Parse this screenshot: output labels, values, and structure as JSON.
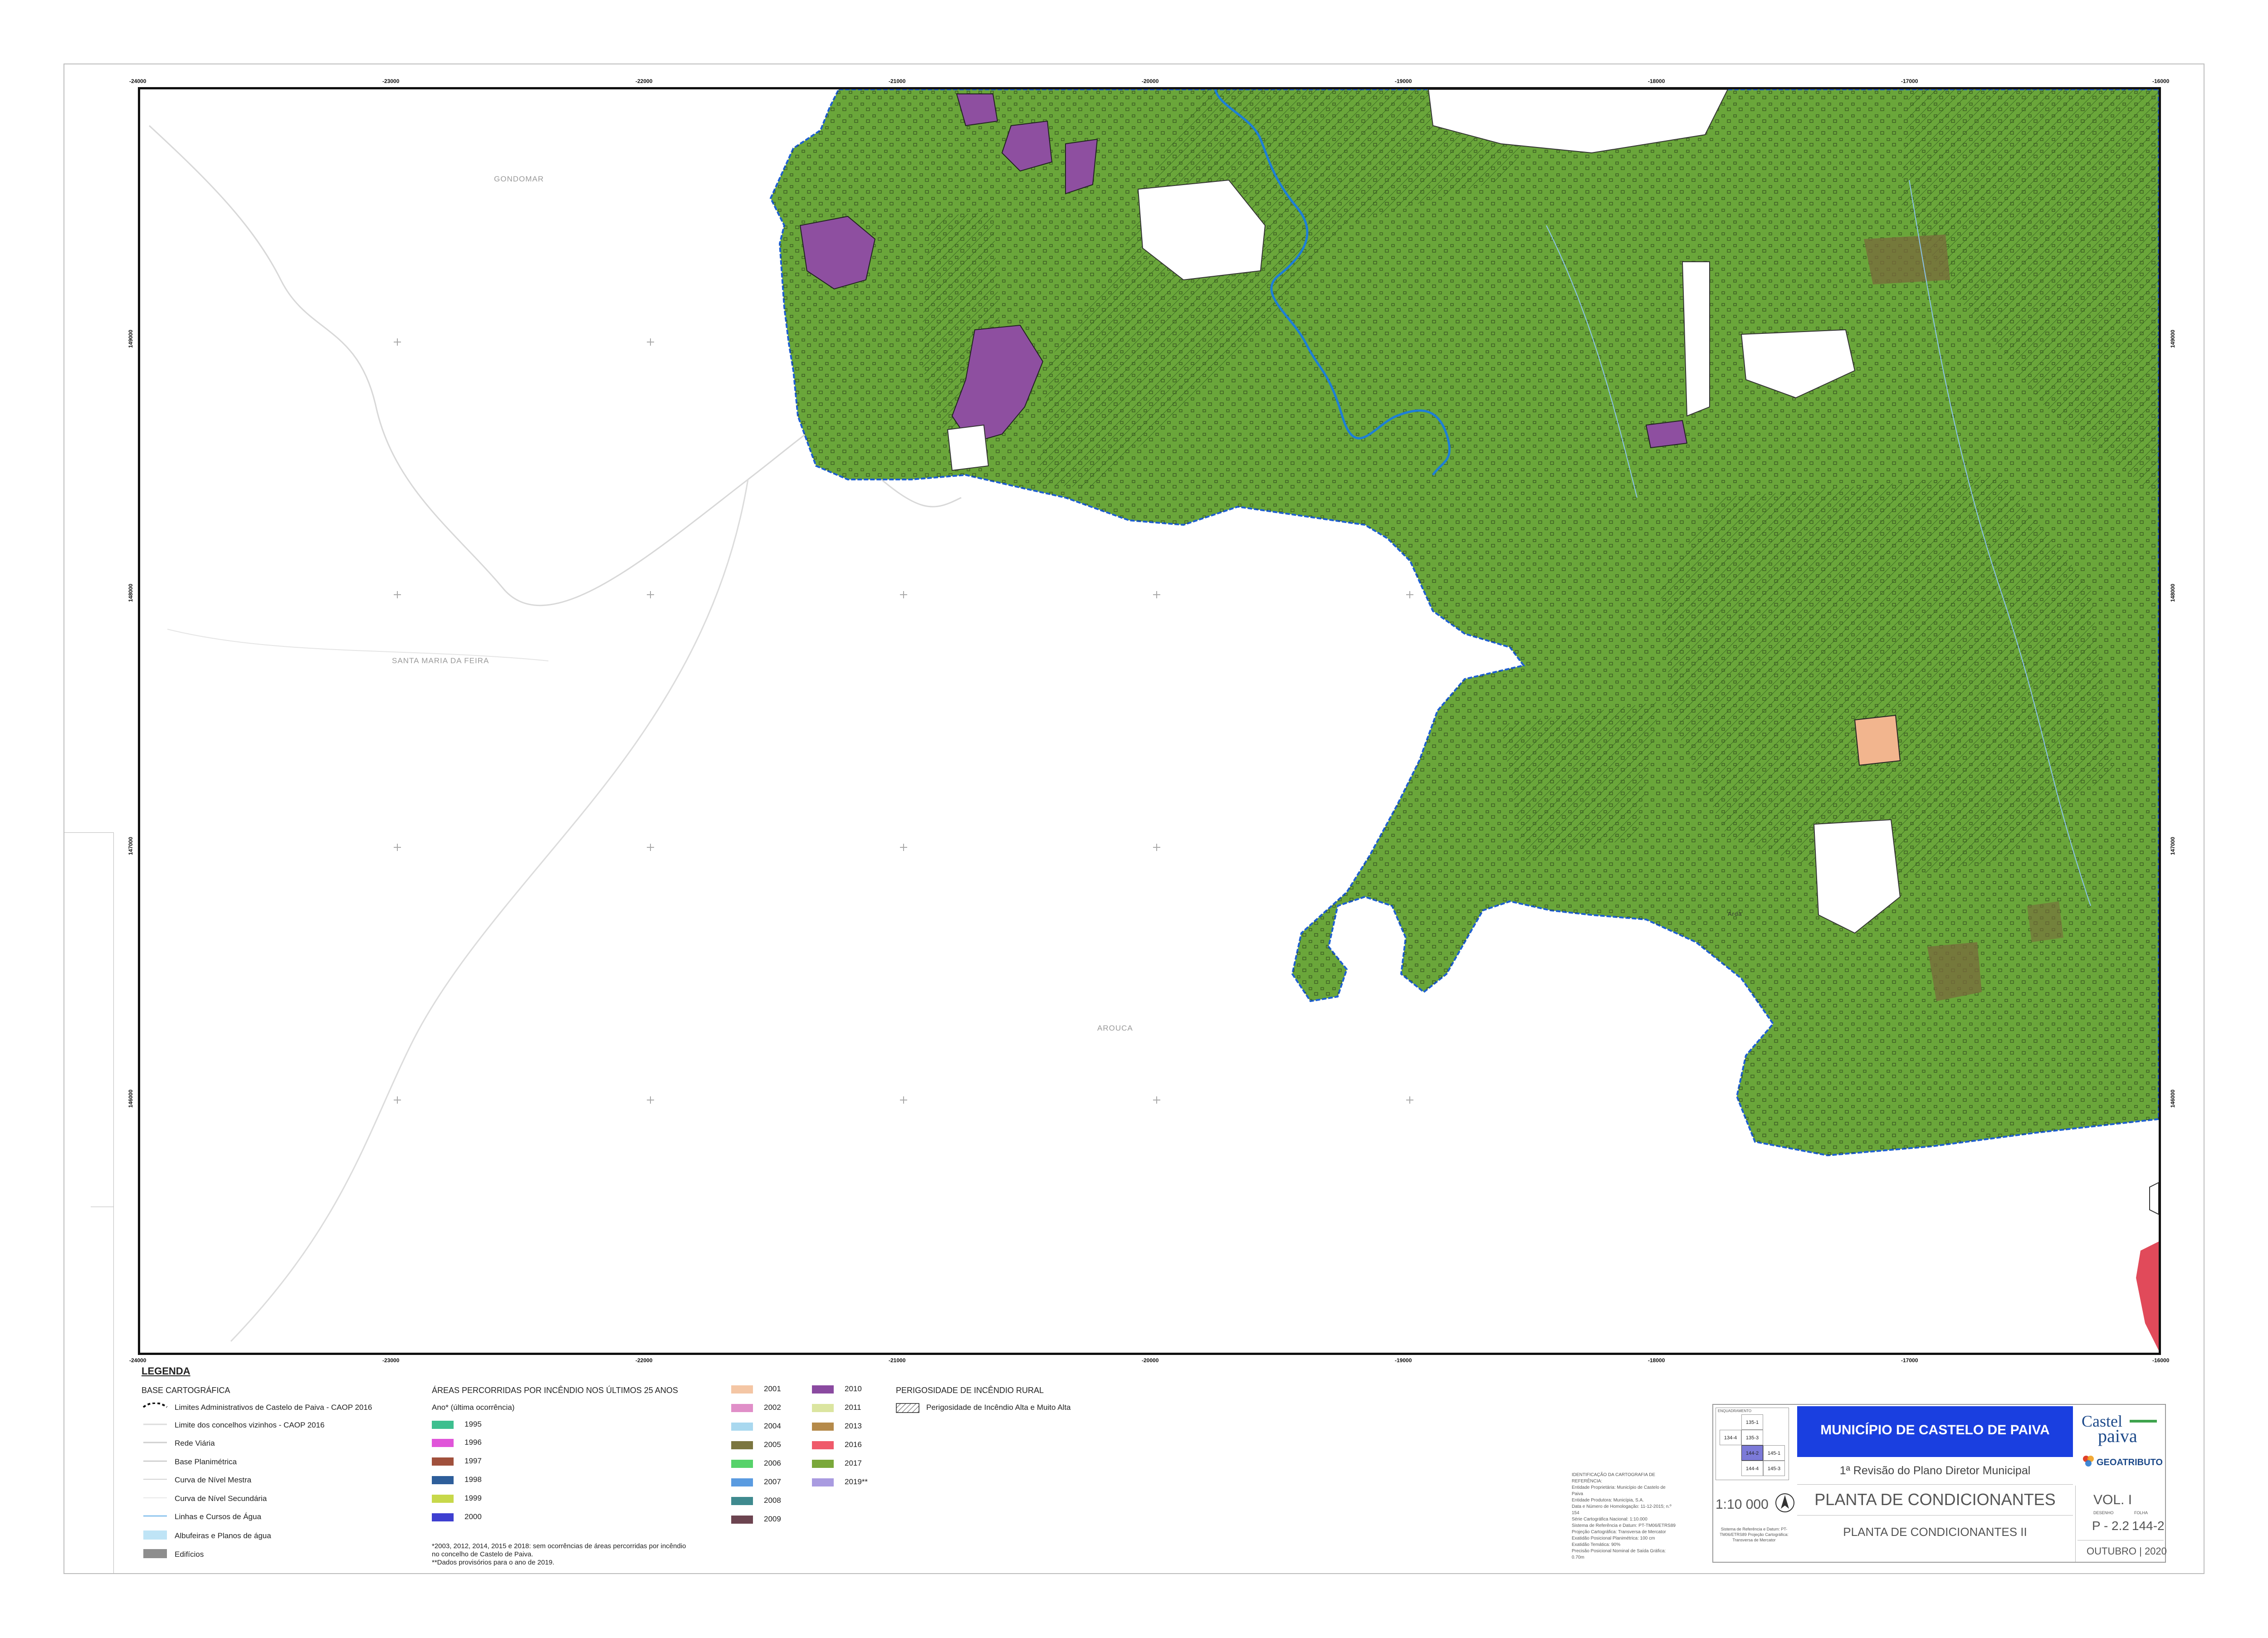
{
  "map": {
    "x_ticks": [
      "-24000",
      "-23000",
      "-22000",
      "-21000",
      "-20000",
      "-19000",
      "-18000",
      "-17000",
      "-16000"
    ],
    "y_ticks": [
      "149000",
      "148000",
      "147000",
      "146000"
    ],
    "municipalities": {
      "gondomar": "GONDOMAR",
      "santa_maria_da_feira": "SANTA MARIA DA FEIRA",
      "arouca": "AROUCA"
    },
    "place_label": "Arda",
    "colors": {
      "forest": "#6aa63a",
      "river": "#1e7fd6",
      "burn_2010": "#8e4fa0",
      "burn_2001": "#f2b58e",
      "burn_2005": "#7a6a3c"
    }
  },
  "legend": {
    "title": "LEGENDA",
    "base": {
      "heading": "BASE CARTOGRÁFICA",
      "items": [
        "Limites Administrativos de Castelo de Paiva - CAOP 2016",
        "Limite dos concelhos vizinhos  - CAOP 2016",
        "Rede Viária",
        "Base Planimétrica",
        "Curva de Nível Mestra",
        "Curva de Nível Secundária",
        "Linhas e Cursos de Água",
        "Albufeiras e Planos de água",
        "Edifícios"
      ]
    },
    "burned": {
      "heading": "ÁREAS PERCORRIDAS POR INCÊNDIO NOS ÚLTIMOS 25 ANOS",
      "subheading": "Ano* (última ocorrência)",
      "col1": [
        {
          "label": "1995",
          "color": "#3dbf8f"
        },
        {
          "label": "1996",
          "color": "#e055d9"
        },
        {
          "label": "1997",
          "color": "#a0503c"
        },
        {
          "label": "1998",
          "color": "#2e5e9a"
        },
        {
          "label": "1999",
          "color": "#c7d84a"
        },
        {
          "label": "2000",
          "color": "#3e3fd0"
        }
      ],
      "col2": [
        {
          "label": "2001",
          "color": "#f4c6a4"
        },
        {
          "label": "2002",
          "color": "#e08fc8"
        },
        {
          "label": "2004",
          "color": "#a9d8ef"
        },
        {
          "label": "2005",
          "color": "#7b7640"
        },
        {
          "label": "2006",
          "color": "#56d26a"
        },
        {
          "label": "2007",
          "color": "#5a9be0"
        },
        {
          "label": "2008",
          "color": "#3f8a8f"
        },
        {
          "label": "2009",
          "color": "#6c4450"
        }
      ],
      "col3": [
        {
          "label": "2010",
          "color": "#8a4aa0"
        },
        {
          "label": "2011",
          "color": "#dbe5a0"
        },
        {
          "label": "2013",
          "color": "#b58a4a"
        },
        {
          "label": "2016",
          "color": "#ef5a6a"
        },
        {
          "label": "2017",
          "color": "#7aa83a"
        },
        {
          "label": "2019**",
          "color": "#a99be0"
        }
      ],
      "note1": "*2003, 2012, 2014, 2015 e 2018: sem ocorrências de áreas percorridas por incêndio",
      "note2": "no concelho de Castelo de Paiva.",
      "note3": "**Dados provisórios para o ano de 2019."
    },
    "risk": {
      "heading": "PERIGOSIDADE DE INCÊNDIO RURAL",
      "item": "Perigosidade de Incêndio Alta e Muito Alta"
    }
  },
  "cartography_notes": [
    "IDENTIFICAÇÃO DA CARTOGRAFIA DE REFERÊNCIA:",
    "Entidade Proprietária: Município de Castelo de Paiva",
    "Entidade Produtora: Municípia, S.A.",
    "Data e Número de Homologação: 11-12-2015; n.º 154",
    "Série Cartográfica Nacional: 1:10.000",
    "Sistema de Referência e Datum: PT-TM06/ETRS89",
    "Projeção Cartográfica: Transversa de Mercator",
    "Exatidão Posicional Planimétrica: 100 cm",
    "Exatidão Temática: 90%",
    "Precisão Posicional Nominal de Saída Gráfica: 0.70m"
  ],
  "title_block": {
    "sheet_index": {
      "caption": "ENQUADRAMENTO",
      "cells": [
        "",
        "135-1",
        "",
        "134-4",
        "135-3",
        "",
        "",
        "144-2",
        "145-1",
        "",
        "144-4",
        "145-3"
      ]
    },
    "scale": "1:10 000",
    "crs_note": "Sistema de Referência e Datum: PT-TM06/ETRS89 Projeção Cartográfica: Transversa de Mercator",
    "municipality": "MUNICÍPIO DE CASTELO DE PAIVA",
    "project": "1ª Revisão do Plano Diretor Municipal",
    "plan": "PLANTA DE CONDICIONANTES",
    "sub_plan": "PLANTA DE CONDICIONANTES II",
    "volume": "VOL. I",
    "drawing_caption": "DESENHO",
    "sheet_caption": "FOLHA",
    "drawing": "P - 2.2",
    "sheet": "144-2",
    "date": "OUTUBRO | 2020",
    "logo_castel": "Castel",
    "logo_paiva": "paiva",
    "logo_geo": "GEOATRIBUTO"
  }
}
